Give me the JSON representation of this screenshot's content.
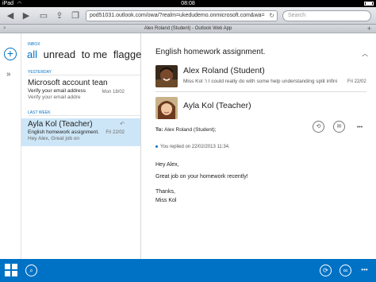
{
  "status_bar": {
    "carrier": "iPad",
    "wifi_icon": "wifi-icon",
    "time": "08:08",
    "battery_icon": "battery-icon"
  },
  "browser": {
    "url": "pod51031.outlook.com/owa/?realm=ukedudemo.onmicrosoft.com&wa=",
    "search_placeholder": "Search",
    "tab_title": "Alex Roland (Student) - Outlook Web App",
    "tab_close": "×",
    "tab_add": "+",
    "back_icon": "back-arrow-icon",
    "forward_icon": "forward-arrow-icon",
    "bookmarks_icon": "bookmarks-icon",
    "share_icon": "share-icon",
    "tabs_icon": "tabs-icon",
    "reload_icon": "reload-icon"
  },
  "list": {
    "folder_label": "INBOX",
    "filters": [
      "all",
      "unread",
      "to me",
      "flagged"
    ],
    "active_filter": "all",
    "groups": {
      "yesterday": "YESTERDAY",
      "last_week": "LAST WEEK"
    },
    "items": [
      {
        "sender": "Microsoft account tean",
        "subject": "Verify your email address",
        "preview": "Verify your email addre",
        "date": "Mon 18/02"
      },
      {
        "sender": "Ayla Kol (Teacher)",
        "subject": "English homework assignment.",
        "preview": "Hey Alex, Great job on",
        "date": "Fri 22/02",
        "selected": true
      }
    ]
  },
  "reading": {
    "title": "English homework assignment.",
    "messages": [
      {
        "sender": "Alex Roland (Student)",
        "preview": "Miss Kol :\\ I could really do with some help understanding split infini",
        "date": "Fri 22/02"
      },
      {
        "sender": "Ayla Kol (Teacher)",
        "to_label": "To:",
        "to_value": "Alex Roland (Student);",
        "replied": "You replied on 22/02/2013 11:34.",
        "body": [
          "Hey Alex,",
          "Great job on your homework recently!",
          "Thanks,",
          "Miss Kol"
        ]
      }
    ],
    "actions": {
      "reply_all": "⟲",
      "forward": "✉",
      "more": "•••"
    }
  },
  "app_bar": {
    "windows_icon": "windows-logo-icon",
    "search": "⌕",
    "sync": "⟳",
    "glasses": "∞",
    "more": "•••"
  },
  "colors": {
    "accent": "#0072c6",
    "selected_row": "#cde6f7"
  }
}
